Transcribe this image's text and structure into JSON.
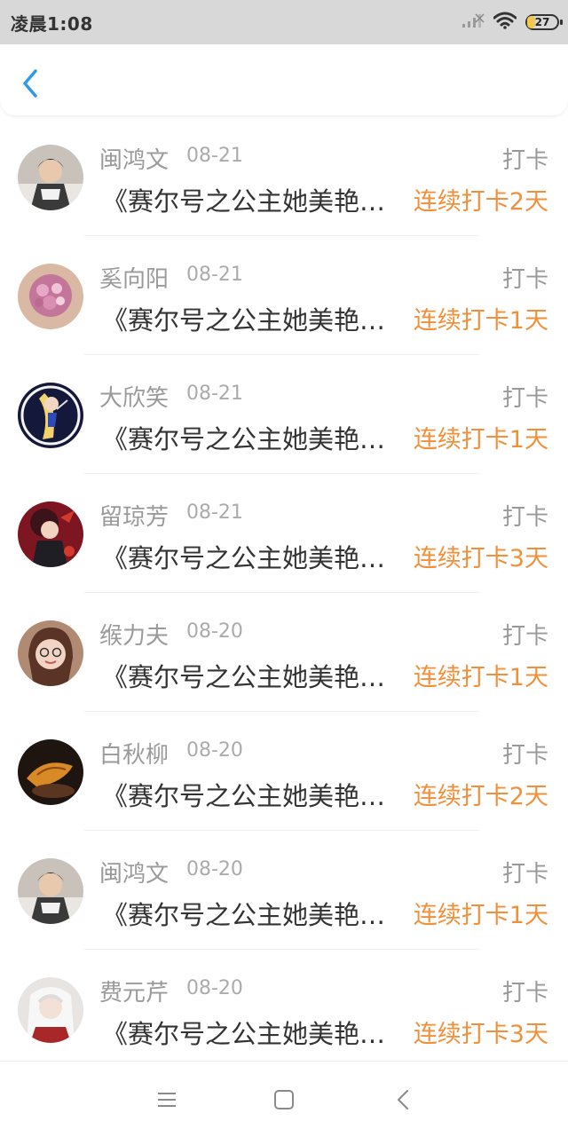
{
  "status_bar": {
    "time": "凌晨1:08",
    "battery": "27",
    "battery_level": 0.27
  },
  "header": {
    "back_icon": "chevron-left-icon",
    "accent": "#2f9be8"
  },
  "colors": {
    "streak": "#f0903a",
    "name": "#9a9a9a",
    "status_bar_bg": "#d8d8d8"
  },
  "items": [
    {
      "name": "闽鸿文",
      "date": "08-21",
      "tag": "打卡",
      "book": "《赛尔号之公主她美艳无双》",
      "streak": "连续打卡2天"
    },
    {
      "name": "奚向阳",
      "date": "08-21",
      "tag": "打卡",
      "book": "《赛尔号之公主她美艳无双》",
      "streak": "连续打卡1天"
    },
    {
      "name": "大欣笑",
      "date": "08-21",
      "tag": "打卡",
      "book": "《赛尔号之公主她美艳无双》",
      "streak": "连续打卡1天"
    },
    {
      "name": "留琼芳",
      "date": "08-21",
      "tag": "打卡",
      "book": "《赛尔号之公主她美艳无双》",
      "streak": "连续打卡3天"
    },
    {
      "name": "缑力夫",
      "date": "08-20",
      "tag": "打卡",
      "book": "《赛尔号之公主她美艳无双》",
      "streak": "连续打卡1天"
    },
    {
      "name": "白秋柳",
      "date": "08-20",
      "tag": "打卡",
      "book": "《赛尔号之公主她美艳无双》",
      "streak": "连续打卡2天"
    },
    {
      "name": "闽鸿文",
      "date": "08-20",
      "tag": "打卡",
      "book": "《赛尔号之公主她美艳无双》",
      "streak": "连续打卡1天"
    },
    {
      "name": "费元芹",
      "date": "08-20",
      "tag": "打卡",
      "book": "《赛尔号之公主她美艳无双》",
      "streak": "连续打卡3天"
    }
  ],
  "nav_bar": {
    "menu_icon": "menu-icon",
    "home_icon": "square-home-icon",
    "back_icon": "triangle-back-icon"
  }
}
